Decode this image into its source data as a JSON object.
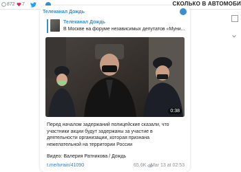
{
  "top_bar": {
    "counter_a": "872",
    "counter_b": "7",
    "headline": "СКОЛЬКО В АВТОМОБИ"
  },
  "post": {
    "channel_name": "Телеканал Дождь",
    "reply": {
      "channel": "Телеканал Дождь",
      "text": "В Москве на форуме независимых депутатов «Муни..."
    },
    "video_duration": "0:38",
    "caption": "Перед началом задержаний полицейские сказали, что участники акции будут задержаны за участие в деятельности организации, которая признана нежелательной на территории России",
    "credit": "Видео: Валерия Ратникова / Дождь",
    "link": "t.me/tvrain/41090",
    "views": "65.6K",
    "date": "Mar 13 at 02:53"
  },
  "colors": {
    "accent": "#3a8fd0",
    "link": "#2d7fc4",
    "meta": "#8a8f94",
    "twitter": "#1da1f2",
    "text": "#222222"
  },
  "icons": [
    "reply-icon",
    "like-icon",
    "twitter-icon",
    "telegram-icon",
    "eye-icon",
    "telegram-logo-icon"
  ]
}
